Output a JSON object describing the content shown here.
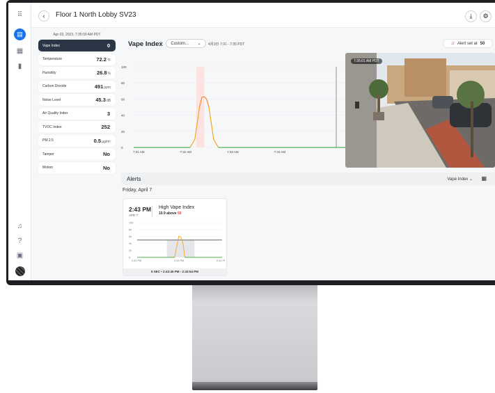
{
  "topbar": {
    "title": "Floor 1 North Lobby SV23",
    "back_icon": "chevron-left-icon",
    "download_icon": "download-icon",
    "settings_icon": "gear-icon"
  },
  "rail": {
    "icons": [
      "grid-menu-icon",
      "sensor-icon",
      "dashboard-icon",
      "bar-chart-icon",
      "bell-icon",
      "help-icon",
      "report-icon",
      "avatar"
    ]
  },
  "sensors": {
    "timestamp": "Apr 03, 2023, 7:35:00 AM PDT",
    "rows": [
      {
        "label": "Vape Index",
        "value": "0",
        "unit": ""
      },
      {
        "label": "Temperature",
        "value": "72.2",
        "unit": "°F"
      },
      {
        "label": "Humidity",
        "value": "26.8",
        "unit": "%"
      },
      {
        "label": "Carbon Dioxide",
        "value": "491",
        "unit": "ppm"
      },
      {
        "label": "Noise Level",
        "value": "45.3",
        "unit": "dB"
      },
      {
        "label": "Air Quality Index",
        "value": "3",
        "unit": ""
      },
      {
        "label": "TVOC Index",
        "value": "252",
        "unit": ""
      },
      {
        "label": "PM 2.5",
        "value": "0.5",
        "unit": "µg/m³"
      },
      {
        "label": "Tamper",
        "value": "No",
        "unit": ""
      },
      {
        "label": "Motion",
        "value": "No",
        "unit": ""
      }
    ]
  },
  "chart_header": {
    "title": "Vape Index",
    "range_select": "Custom...",
    "range_text": "4月3日 7:31 - 7:35 PDT",
    "alert_button": "Alert set at",
    "alert_threshold": "50"
  },
  "chart_data": {
    "type": "line",
    "x": [
      "7:31 AM",
      "7:32 AM",
      "7:33 AM",
      "7:34 AM"
    ],
    "yticks": [
      0,
      20,
      40,
      60,
      80,
      100
    ],
    "ylim": [
      0,
      100
    ],
    "threshold": 50,
    "series": [
      {
        "values_x_min": [
          0,
          1.2,
          1.3,
          1.4,
          1.45,
          1.5,
          1.55,
          1.6,
          1.7,
          1.8,
          4.5
        ],
        "values_y": [
          0,
          0,
          10,
          50,
          62,
          63,
          60,
          50,
          10,
          0,
          0
        ]
      }
    ],
    "colors": {
      "normal": "#4caf50",
      "above": "#f5a623",
      "spike": "#f44336"
    }
  },
  "camera": {
    "timestamp": "7:35:01 AM PDT"
  },
  "alerts": {
    "title": "Alerts",
    "filter": "Vape Index",
    "day": "Friday, April 7",
    "card": {
      "time": "2:43 PM",
      "date": "APR 7",
      "name": "High Vape Index",
      "value": "10.9",
      "above_text": "above",
      "threshold": "50",
      "footer": "9 SEC  •  2:43:45 PM - 2:43:54 PM",
      "chart": {
        "x": [
          "2:42 PM",
          "2:43 PM",
          "2:44 PM"
        ],
        "yticks": [
          0,
          20,
          40,
          60,
          80,
          100
        ],
        "threshold": 50,
        "peak": 61
      }
    }
  }
}
